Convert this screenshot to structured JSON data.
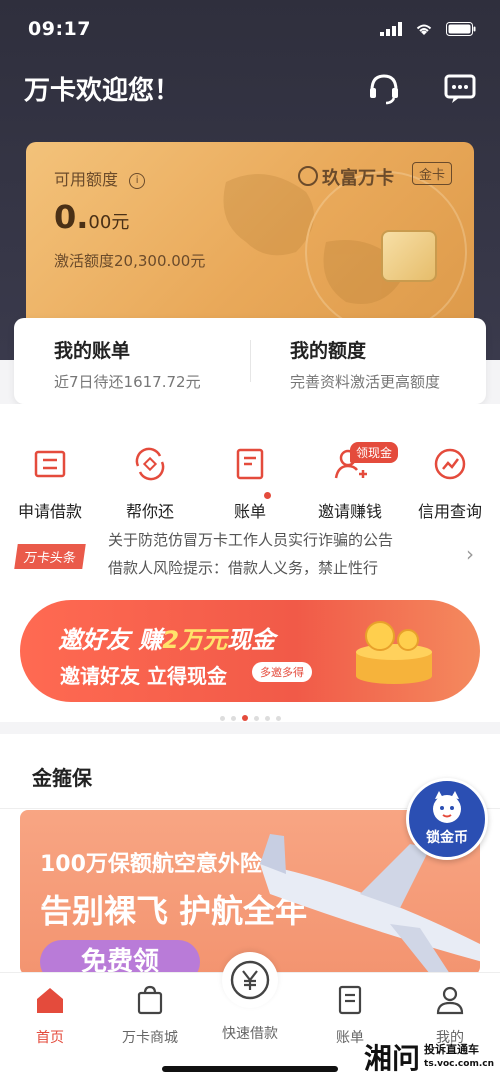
{
  "status": {
    "time": "09:17"
  },
  "header": {
    "welcome": "万卡欢迎您！"
  },
  "card": {
    "label": "可用额度",
    "amount_main": "0.",
    "amount_decimal": "00",
    "amount_unit": "元",
    "activate_text": "激活额度20,300.00元",
    "brand": "玖富万卡",
    "tier": "金卡"
  },
  "bill": {
    "left_title": "我的账单",
    "left_sub": "近7日待还1617.72元",
    "right_title": "我的额度",
    "right_sub": "完善资料激活更高额度"
  },
  "shortcuts": [
    {
      "label": "申请借款",
      "icon": "apply-loan-icon"
    },
    {
      "label": "帮你还",
      "icon": "repay-help-icon"
    },
    {
      "label": "账单",
      "icon": "bill-icon"
    },
    {
      "label": "邀请赚钱",
      "icon": "invite-icon"
    },
    {
      "label": "信用查询",
      "icon": "credit-query-icon"
    }
  ],
  "shortcut_badge": "领现金",
  "news": {
    "tag": "万卡头条",
    "line1": "关于防范仿冒万卡工作人员实行诈骗的公告",
    "line2": "借款人风险提示：借款人义务，禁止性行"
  },
  "promo": {
    "line1_a": "邀好友 赚",
    "line1_b": "2万元",
    "line1_c": "现金",
    "line2": "邀请好友 立得现金",
    "pill": "多邀多得"
  },
  "section": {
    "title": "金箍保"
  },
  "insurance": {
    "line1": "100万保额航空意外险",
    "line2": "告别裸飞 护航全年",
    "cta": "免费领"
  },
  "floating": {
    "text": "锁金币"
  },
  "tabs": [
    {
      "label": "首页",
      "active": true
    },
    {
      "label": "万卡商城",
      "active": false
    },
    {
      "label": "快速借款",
      "active": false
    },
    {
      "label": "账单",
      "active": false
    },
    {
      "label": "我的",
      "active": false
    }
  ],
  "watermark": {
    "big": "湘问",
    "small1": "投诉直通车",
    "small2": "ts.voc.com.cn"
  },
  "colors": {
    "accent": "#e44b3c",
    "gold": "#e9a95a",
    "dark": "#2f2f3d"
  }
}
